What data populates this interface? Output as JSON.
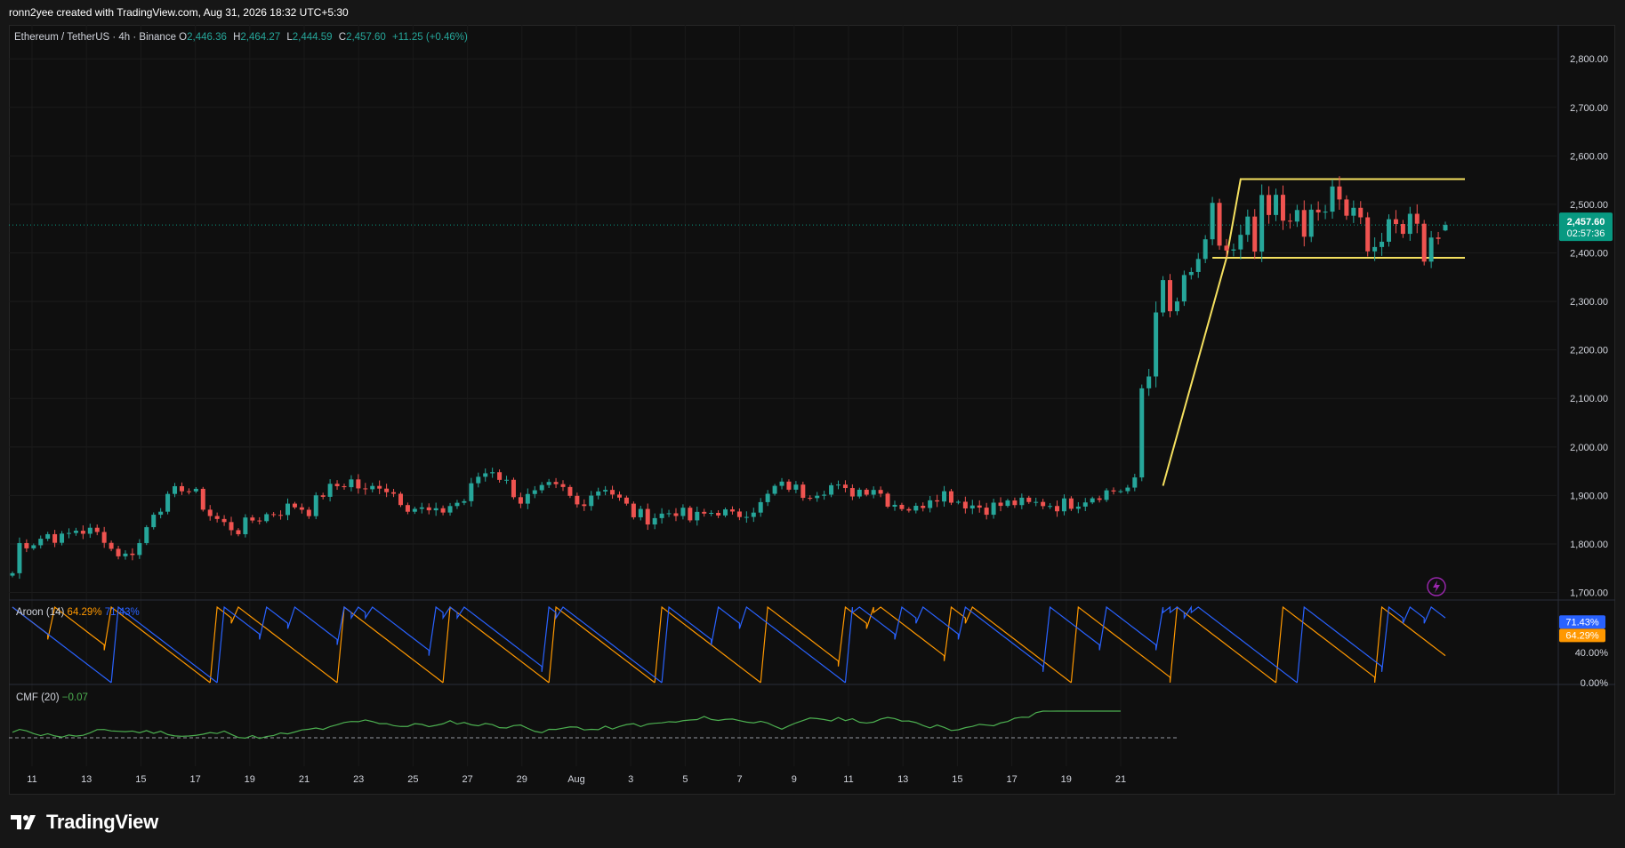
{
  "header": {
    "created_by": "ronn2yee created with TradingView.com, Aug 31, 2026 18:32 UTC+5:30"
  },
  "legend": {
    "symbol": "Ethereum / TetherUS · 4h · Binance",
    "o_label": "O",
    "o": "2,446.36",
    "h_label": "H",
    "h": "2,464.27",
    "l_label": "L",
    "l": "2,444.59",
    "c_label": "C",
    "c": "2,457.60",
    "change": "+11.25 (+0.46%)"
  },
  "price_badge": {
    "price": "2,457.60",
    "countdown": "02:57:36"
  },
  "aroon": {
    "label": "Aroon (14)",
    "v1": "64.29%",
    "v2": "71.43%"
  },
  "cmf": {
    "label": "CMF (20)",
    "value": "−0.07"
  },
  "brand": {
    "name": "TradingView"
  },
  "colors": {
    "up": "#26a69a",
    "down": "#ef5350",
    "pattern": "#f5e05f",
    "aroon_up": "#ff9800",
    "aroon_down": "#2962ff",
    "cmf": "#4caf50",
    "badge": "#089981"
  },
  "chart_data": [
    {
      "type": "candlestick",
      "title": "Ethereum / TetherUS · 4h · Binance",
      "x_ticks": [
        "11",
        "13",
        "15",
        "17",
        "19",
        "21",
        "23",
        "25",
        "27",
        "29",
        "Aug",
        "3",
        "5",
        "7",
        "9",
        "11",
        "13",
        "15",
        "17",
        "19",
        "21"
      ],
      "y_ticks": [
        "2,800.00",
        "2,700.00",
        "2,600.00",
        "2,500.00",
        "2,400.00",
        "2,300.00",
        "2,200.00",
        "2,100.00",
        "2,000.00",
        "1,900.00",
        "1,800.00",
        "1,700.00"
      ],
      "ylim": [
        1690,
        2870
      ],
      "last_price": 2457.6,
      "close_path": [
        [
          0,
          1740
        ],
        [
          1,
          1800
        ],
        [
          3,
          1805
        ],
        [
          5,
          1820
        ],
        [
          7,
          1810
        ],
        [
          9,
          1830
        ],
        [
          11,
          1825
        ],
        [
          13,
          1815
        ],
        [
          14,
          1790
        ],
        [
          16,
          1775
        ],
        [
          18,
          1800
        ],
        [
          20,
          1870
        ],
        [
          22,
          1890
        ],
        [
          24,
          1920
        ],
        [
          26,
          1900
        ],
        [
          28,
          1860
        ],
        [
          30,
          1840
        ],
        [
          32,
          1830
        ],
        [
          34,
          1850
        ],
        [
          36,
          1860
        ],
        [
          38,
          1870
        ],
        [
          40,
          1880
        ],
        [
          42,
          1870
        ],
        [
          44,
          1905
        ],
        [
          46,
          1920
        ],
        [
          48,
          1930
        ],
        [
          50,
          1905
        ],
        [
          52,
          1925
        ],
        [
          54,
          1905
        ],
        [
          56,
          1880
        ],
        [
          58,
          1870
        ],
        [
          60,
          1860
        ],
        [
          62,
          1880
        ],
        [
          64,
          1890
        ],
        [
          66,
          1940
        ],
        [
          68,
          1955
        ],
        [
          70,
          1925
        ],
        [
          72,
          1890
        ],
        [
          74,
          1900
        ],
        [
          76,
          1915
        ],
        [
          78,
          1910
        ],
        [
          80,
          1880
        ],
        [
          82,
          1905
        ],
        [
          84,
          1920
        ],
        [
          86,
          1890
        ],
        [
          88,
          1862
        ],
        [
          90,
          1855
        ],
        [
          92,
          1860
        ],
        [
          94,
          1870
        ],
        [
          96,
          1850
        ],
        [
          98,
          1860
        ],
        [
          100,
          1870
        ],
        [
          102,
          1855
        ],
        [
          104,
          1870
        ],
        [
          106,
          1880
        ],
        [
          108,
          1915
        ],
        [
          110,
          1920
        ],
        [
          112,
          1905
        ],
        [
          114,
          1912
        ],
        [
          116,
          1920
        ],
        [
          118,
          1905
        ],
        [
          120,
          1912
        ],
        [
          122,
          1918
        ],
        [
          124,
          1890
        ],
        [
          126,
          1880
        ],
        [
          128,
          1870
        ],
        [
          130,
          1900
        ],
        [
          132,
          1905
        ],
        [
          134,
          1890
        ],
        [
          136,
          1880
        ],
        [
          138,
          1875
        ],
        [
          140,
          1880
        ],
        [
          142,
          1885
        ],
        [
          144,
          1880
        ],
        [
          146,
          1885
        ],
        [
          148,
          1880
        ],
        [
          150,
          1885
        ],
        [
          152,
          1895
        ],
        [
          154,
          1905
        ],
        [
          156,
          1910
        ],
        [
          158,
          1915
        ],
        [
          159,
          1925
        ],
        [
          160,
          2120
        ],
        [
          161,
          2150
        ],
        [
          162,
          2300
        ],
        [
          163,
          2320
        ],
        [
          164,
          2270
        ],
        [
          165,
          2300
        ],
        [
          166,
          2330
        ],
        [
          167,
          2350
        ],
        [
          168,
          2390
        ],
        [
          169,
          2400
        ],
        [
          170,
          2480
        ],
        [
          171,
          2420
        ],
        [
          172,
          2405
        ],
        [
          173,
          2395
        ],
        [
          174,
          2420
        ],
        [
          175,
          2450
        ],
        [
          176,
          2400
        ],
        [
          177,
          2490
        ],
        [
          178,
          2470
        ],
        [
          179,
          2500
        ],
        [
          180,
          2470
        ],
        [
          181,
          2490
        ],
        [
          182,
          2460
        ],
        [
          183,
          2430
        ],
        [
          184,
          2480
        ],
        [
          185,
          2490
        ],
        [
          186,
          2470
        ],
        [
          187,
          2520
        ],
        [
          188,
          2510
        ],
        [
          189,
          2480
        ],
        [
          190,
          2470
        ],
        [
          191,
          2460
        ],
        [
          192,
          2430
        ],
        [
          193,
          2420
        ],
        [
          194,
          2425
        ],
        [
          195,
          2440
        ],
        [
          196,
          2450
        ],
        [
          197,
          2460
        ],
        [
          198,
          2470
        ],
        [
          199,
          2480
        ],
        [
          200,
          2400
        ],
        [
          201,
          2430
        ],
        [
          202,
          2440
        ],
        [
          203,
          2457.6
        ]
      ]
    },
    {
      "type": "line",
      "title": "Aroon (14)",
      "ylim": [
        0,
        100
      ],
      "y_ticks": [
        "40.00%",
        "0.00%"
      ],
      "series": [
        {
          "name": "Aroon Up",
          "last": 64.29
        },
        {
          "name": "Aroon Down",
          "last": 71.43
        }
      ]
    },
    {
      "type": "line",
      "title": "CMF (20)",
      "series": [
        {
          "name": "CMF",
          "last": -0.07
        }
      ]
    }
  ]
}
